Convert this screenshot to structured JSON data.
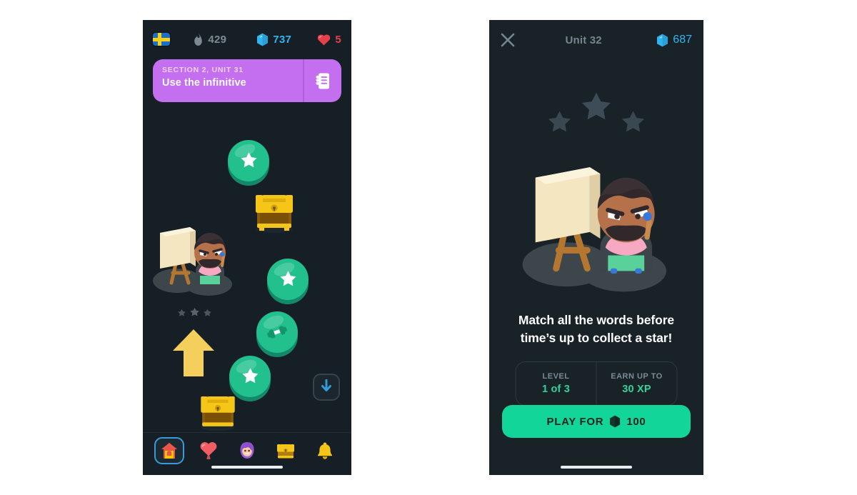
{
  "colors": {
    "left_bg": "#161f26",
    "right_bg": "#182227",
    "banner_purple": "#c46ef0",
    "node_green": "#22c08d",
    "play_green": "#12d59a",
    "gem_blue": "#32b4f0",
    "heart_red": "#e8404b",
    "chest_gold": "#f5c518",
    "arrow_yellow": "#f5cf5b",
    "accent_teal": "#2fd49b"
  },
  "left_phone": {
    "topbar": {
      "flag": {
        "icon": "swedish-flag-icon",
        "alt": "Swedish flag"
      },
      "streak": {
        "icon": "flame-icon",
        "value": "429"
      },
      "gems": {
        "icon": "gem-icon",
        "value": "737"
      },
      "hearts": {
        "icon": "heart-icon",
        "value": "5"
      }
    },
    "section_banner": {
      "kicker": "SECTION 2, UNIT 31",
      "title": "Use the infinitive",
      "button_icon": "notebook-list-icon"
    },
    "path_nodes": [
      {
        "id": "node-1",
        "type": "lesson",
        "glyph": "star-icon",
        "state": "complete"
      },
      {
        "id": "chest-1",
        "type": "chest",
        "glyph": "treasure-chest-icon",
        "state": "locked"
      },
      {
        "id": "node-2",
        "type": "lesson",
        "glyph": "star-icon",
        "state": "complete"
      },
      {
        "id": "node-3",
        "type": "lesson",
        "glyph": "dumbbell-icon",
        "state": "practice"
      },
      {
        "id": "node-4",
        "type": "lesson",
        "glyph": "star-icon",
        "state": "current"
      },
      {
        "id": "chest-2",
        "type": "chest",
        "glyph": "treasure-chest-icon",
        "state": "locked"
      }
    ],
    "path_decor": {
      "character": "artist-character",
      "mini_stars": "three-gray-stars",
      "pointer": "yellow-up-arrow",
      "scroll_button_icon": "arrow-down-icon"
    },
    "bottom_nav": [
      {
        "id": "home",
        "icon": "house-icon",
        "label": "Learn",
        "selected": true
      },
      {
        "id": "hearts",
        "icon": "heart-icon",
        "label": "Hearts",
        "selected": false
      },
      {
        "id": "profile",
        "icon": "avatar-icon",
        "label": "Profile",
        "selected": false
      },
      {
        "id": "chest",
        "icon": "chest-icon",
        "label": "Quests",
        "selected": false
      },
      {
        "id": "bell",
        "icon": "bell-icon",
        "label": "Alerts",
        "selected": false
      }
    ]
  },
  "right_phone": {
    "topbar": {
      "close_icon": "close-icon",
      "title": "Unit 32",
      "gems": {
        "icon": "gem-icon",
        "value": "687"
      }
    },
    "stars": {
      "icon": "star-icon",
      "count": 3,
      "state": "empty"
    },
    "character": "artist-character",
    "headline": "Match all the words before time’s up to collect a star!",
    "info": [
      {
        "label": "LEVEL",
        "value": "1 of 3"
      },
      {
        "label": "EARN UP TO",
        "value": "30 XP"
      }
    ],
    "play_button": {
      "prefix": "PLAY FOR",
      "gem_icon": "gem-icon",
      "cost": "100"
    }
  }
}
